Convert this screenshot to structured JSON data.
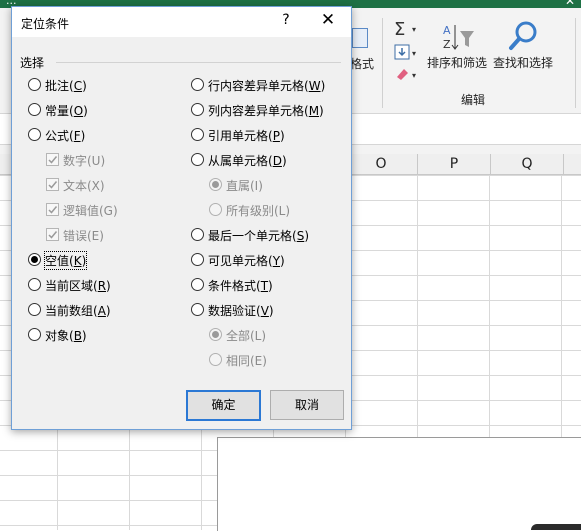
{
  "excel": {
    "title_fragment": "...",
    "window_close": "✕",
    "ribbon": {
      "format_label_fragment": "格式",
      "sort_filter_label": "排序和筛选",
      "find_select_label": "查找和选择",
      "group_label": "编辑"
    },
    "columns": [
      "O",
      "P",
      "Q"
    ]
  },
  "dialog": {
    "title": "定位条件",
    "help_label": "?",
    "close_label": "✕",
    "group_label": "选择",
    "left_options": [
      {
        "text": "批注(",
        "key": "C",
        "tail": ")"
      },
      {
        "text": "常量(",
        "key": "O",
        "tail": ")"
      },
      {
        "text": "公式(",
        "key": "F",
        "tail": ")"
      },
      {
        "text": "数字(U)"
      },
      {
        "text": "文本(X)"
      },
      {
        "text": "逻辑值(G)"
      },
      {
        "text": "错误(E)"
      },
      {
        "text": "空值(",
        "key": "K",
        "tail": ")"
      },
      {
        "text": "当前区域(",
        "key": "R",
        "tail": ")"
      },
      {
        "text": "当前数组(",
        "key": "A",
        "tail": ")"
      },
      {
        "text": "对象(",
        "key": "B",
        "tail": ")"
      }
    ],
    "right_options": [
      {
        "text": "行内容差异单元格(",
        "key": "W",
        "tail": ")"
      },
      {
        "text": "列内容差异单元格(",
        "key": "M",
        "tail": ")"
      },
      {
        "text": "引用单元格(",
        "key": "P",
        "tail": ")"
      },
      {
        "text": "从属单元格(",
        "key": "D",
        "tail": ")"
      },
      {
        "text": "直属(I)"
      },
      {
        "text": "所有级别(L)"
      },
      {
        "text": "最后一个单元格(",
        "key": "S",
        "tail": ")"
      },
      {
        "text": "可见单元格(",
        "key": "Y",
        "tail": ")"
      },
      {
        "text": "条件格式(",
        "key": "T",
        "tail": ")"
      },
      {
        "text": "数据验证(",
        "key": "V",
        "tail": ")"
      },
      {
        "text": "全部(L)"
      },
      {
        "text": "相同(E)"
      }
    ],
    "selected_option": "空值(K)",
    "ok_label": "确定",
    "cancel_label": "取消"
  }
}
